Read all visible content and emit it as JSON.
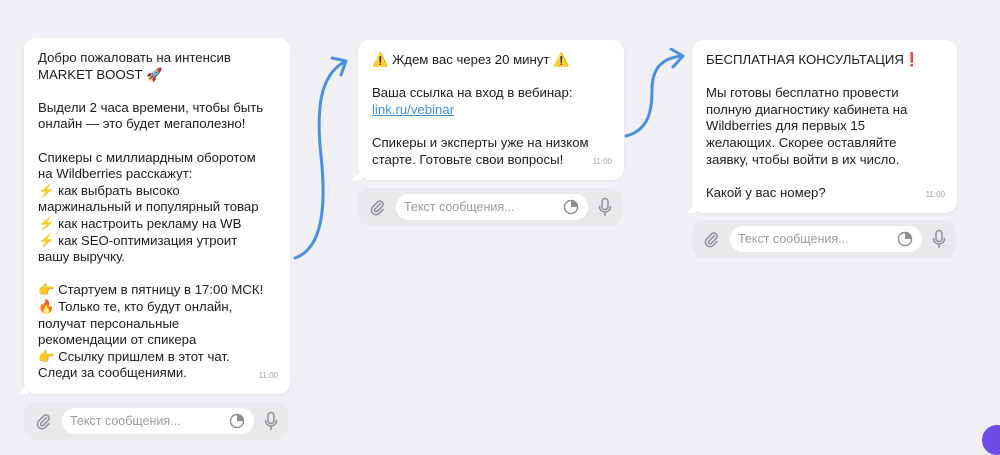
{
  "messages": [
    {
      "lines": [
        "Добро пожаловать на интенсив",
        "MARKET BOOST 🚀",
        "",
        "Выдели 2 часа времени, чтобы быть",
        "онлайн — это будет мегаполезно!",
        "",
        "Спикеры с миллиардным оборотом",
        "на Wildberries расскажут:",
        "⚡ как выбрать высоко",
        "маржинальный и популярный товар",
        "⚡ как настроить рекламу на WB",
        "⚡ как SEO-оптимизация утроит",
        "вашу выручку.",
        "",
        "👉 Стартуем в пятницу в 17:00 МСК!",
        "🔥 Только те, кто будут онлайн,",
        "получат персональные",
        "рекомендации от спикера",
        "👉 Ссылку пришлем в этот чат.",
        "Следи за сообщениями."
      ],
      "time": "11:00"
    },
    {
      "lines": [
        "⚠️ Ждем вас через 20 минут ⚠️",
        "",
        "Ваша ссылка на вход в вебинар:",
        "",
        "",
        "Спикеры и эксперты уже на низком",
        "старте. Готовьте свои вопросы!"
      ],
      "link": "link.ru/vebinar",
      "time": "11:00"
    },
    {
      "lines": [
        "БЕСПЛАТНАЯ КОНСУЛЬТАЦИЯ❗",
        "",
        "Мы готовы бесплатно провести",
        "полную диагностику кабинета на",
        "Wildberries для первых 15",
        "желающих. Скорее оставляйте",
        "заявку, чтобы войти в их число.",
        "",
        "Какой у вас номер?"
      ],
      "time": "11:00"
    }
  ],
  "input": {
    "placeholder": "Текст сообщения..."
  },
  "icons": {
    "attach": "paperclip-icon",
    "sticker": "sticker-icon",
    "mic": "microphone-icon",
    "arrow": "curved-arrow-icon"
  },
  "colors": {
    "background": "#f0f0f4",
    "bubble": "#ffffff",
    "arrow": "#4a90e2",
    "link": "#3b8fe0",
    "input_bar": "#e9e9ec"
  }
}
